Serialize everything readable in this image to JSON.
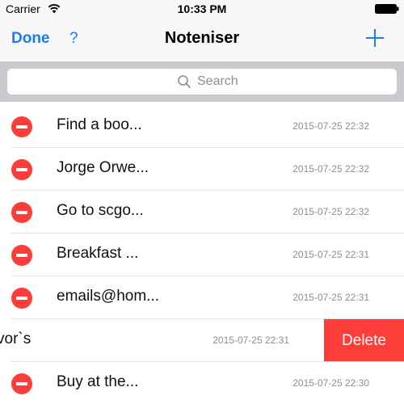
{
  "status_bar": {
    "carrier": "Carrier",
    "time": "10:33 PM",
    "wifi_icon": "wifi-icon",
    "battery_icon": "battery-icon"
  },
  "nav": {
    "done_label": "Done",
    "help_label": "?",
    "title": "Noteniser",
    "add_icon": "plus-icon",
    "accent_color": "#1a7cf5"
  },
  "search": {
    "placeholder": "Search",
    "icon": "search-icon"
  },
  "notes": [
    {
      "title": "Find a boo...",
      "date": "2015-07-25 22:32"
    },
    {
      "title": "Jorge Orwe...",
      "date": "2015-07-25 22:32"
    },
    {
      "title": "Go to scgo...",
      "date": "2015-07-25 22:32"
    },
    {
      "title": "Breakfast ...",
      "date": "2015-07-25 22:31"
    },
    {
      "title": "emails@hom...",
      "date": "2015-07-25 22:31"
    },
    {
      "title": "vor`s",
      "date": "2015-07-25 22:31",
      "swiped": true,
      "delete_label": "Delete"
    },
    {
      "title": "Buy at the...",
      "date": "2015-07-25 22:30"
    }
  ],
  "colors": {
    "delete_red": "#fc3d39",
    "search_bg": "#c9c9ce",
    "bar_bg": "#f7f7f7"
  }
}
